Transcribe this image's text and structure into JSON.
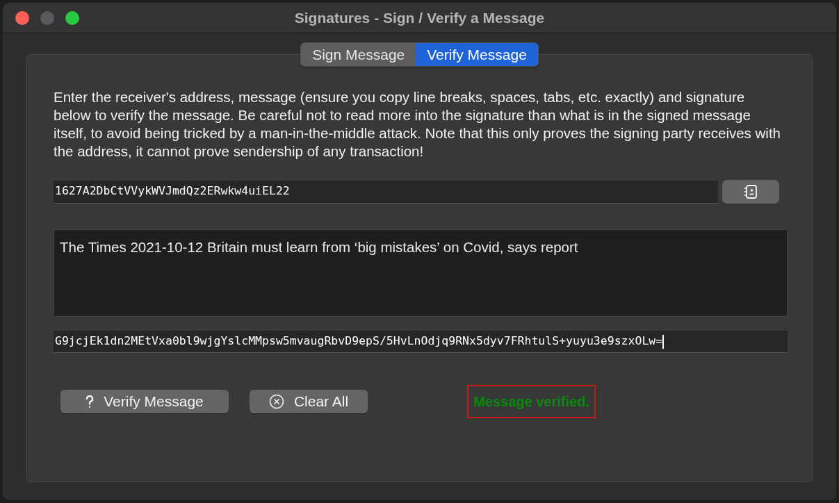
{
  "window": {
    "title": "Signatures - Sign / Verify a Message"
  },
  "tabs": [
    {
      "label": "Sign Message",
      "selected": false
    },
    {
      "label": "Verify Message",
      "selected": true
    }
  ],
  "description": "Enter the receiver's address, message (ensure you copy line breaks, spaces, tabs, etc. exactly) and signature below to verify the message. Be careful not to read more into the signature than what is in the signed message itself, to avoid being tricked by a man-in-the-middle attack. Note that this only proves the signing party receives with the address, it cannot prove sendership of any transaction!",
  "address": {
    "value": "1627A2DbCtVVykWVJmdQz2ERwkw4uiEL22"
  },
  "message": {
    "value": "The Times 2021-10-12 Britain must learn from ‘big mistakes’ on Covid, says report"
  },
  "signature": {
    "value": "G9jcjEk1dn2MEtVxa0bl9wjgYslcMMpsw5mvaugRbvD9epS/5HvLnOdjq9RNx5dyv7FRhtulS+yuyu3e9szxOLw="
  },
  "buttons": [
    {
      "kind": "verify",
      "label": "Verify Message"
    },
    {
      "kind": "clear",
      "label": "Clear All"
    }
  ],
  "status": {
    "text": "Message verified.",
    "color": "#0a8a0a"
  }
}
